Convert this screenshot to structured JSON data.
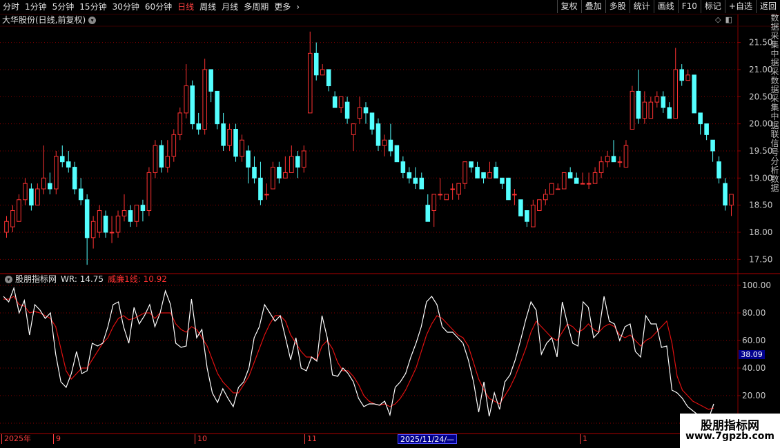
{
  "toolbar": {
    "periods": [
      "分时",
      "1分钟",
      "5分钟",
      "15分钟",
      "30分钟",
      "60分钟",
      "日线",
      "周线",
      "月线",
      "多周期",
      "更多"
    ],
    "active_period": "日线",
    "more_arrow": "chevron-right-icon",
    "right_buttons": [
      "复权",
      "叠加",
      "多股",
      "统计",
      "画线",
      "F10",
      "标记",
      "+自选",
      "返回"
    ]
  },
  "stock": {
    "title": "大华股份(日线,前复权)",
    "dropdown_icon": "chevron-down-icon"
  },
  "top_icons": [
    "diamond-icon",
    "window-icon"
  ],
  "indicator": {
    "name": "股朋指标网",
    "wr_label": "WR: 14.75",
    "line1_label": "威廉1线: 10.92",
    "wr_tag": "38.09"
  },
  "dates": {
    "year_label": "2025年",
    "m9": "9",
    "m10": "10",
    "m11": "11",
    "cursor": "2025/11/24/—",
    "m1": "1"
  },
  "watermark": {
    "name": "股朋指标网",
    "url": "www.7gpzb.com"
  },
  "right_strip_text": [
    "数",
    "据",
    "采",
    "集",
    "中",
    "据",
    "采",
    "数",
    "据",
    "采",
    "集",
    "中",
    "据",
    "联",
    "信",
    "号",
    "分",
    "析",
    "数",
    "据"
  ],
  "colors": {
    "up": "#ff3232",
    "down": "#54ffff",
    "grid": "#8b0000",
    "wr_line": "#ffffff",
    "line1": "#e01010",
    "axis_text": "#c8c8c8"
  },
  "chart_data": [
    {
      "type": "candlestick",
      "title": "大华股份(日线,前复权)",
      "ylim": [
        17.25,
        21.8
      ],
      "y_ticks": [
        17.5,
        18.0,
        18.5,
        19.0,
        19.5,
        20.0,
        20.5,
        21.0,
        21.5
      ],
      "y_tick_labels": [
        "17.50",
        "18.00",
        "18.50",
        "19.00",
        "19.50",
        "20.00",
        "20.50",
        "21.00",
        "21.50"
      ],
      "grid": true,
      "candles": [
        {
          "o": 18.0,
          "h": 18.3,
          "l": 17.9,
          "c": 18.2
        },
        {
          "o": 18.1,
          "h": 18.5,
          "l": 18.0,
          "c": 18.4
        },
        {
          "o": 18.2,
          "h": 18.7,
          "l": 18.2,
          "c": 18.6
        },
        {
          "o": 18.6,
          "h": 19.0,
          "l": 18.5,
          "c": 18.9
        },
        {
          "o": 18.8,
          "h": 18.9,
          "l": 18.4,
          "c": 18.5
        },
        {
          "o": 18.5,
          "h": 18.9,
          "l": 18.5,
          "c": 18.8
        },
        {
          "o": 18.8,
          "h": 19.6,
          "l": 18.7,
          "c": 19.0
        },
        {
          "o": 18.9,
          "h": 19.1,
          "l": 18.7,
          "c": 18.8
        },
        {
          "o": 18.8,
          "h": 19.5,
          "l": 18.7,
          "c": 19.4
        },
        {
          "o": 19.4,
          "h": 19.6,
          "l": 19.2,
          "c": 19.3
        },
        {
          "o": 19.3,
          "h": 19.5,
          "l": 19.1,
          "c": 19.2
        },
        {
          "o": 19.2,
          "h": 19.3,
          "l": 18.7,
          "c": 18.8
        },
        {
          "o": 18.8,
          "h": 19.0,
          "l": 18.5,
          "c": 18.6
        },
        {
          "o": 18.6,
          "h": 18.7,
          "l": 17.4,
          "c": 17.9
        },
        {
          "o": 17.9,
          "h": 18.3,
          "l": 17.7,
          "c": 18.2
        },
        {
          "o": 18.0,
          "h": 18.5,
          "l": 17.9,
          "c": 18.4
        },
        {
          "o": 18.3,
          "h": 18.4,
          "l": 17.9,
          "c": 18.0
        },
        {
          "o": 18.0,
          "h": 18.3,
          "l": 17.8,
          "c": 18.0
        },
        {
          "o": 18.0,
          "h": 18.4,
          "l": 17.9,
          "c": 18.3
        },
        {
          "o": 18.3,
          "h": 18.7,
          "l": 18.2,
          "c": 18.4
        },
        {
          "o": 18.4,
          "h": 18.5,
          "l": 18.1,
          "c": 18.2
        },
        {
          "o": 18.2,
          "h": 18.5,
          "l": 18.1,
          "c": 18.5
        },
        {
          "o": 18.5,
          "h": 18.6,
          "l": 18.2,
          "c": 18.4
        },
        {
          "o": 18.4,
          "h": 19.2,
          "l": 18.3,
          "c": 19.1
        },
        {
          "o": 19.1,
          "h": 19.7,
          "l": 19.0,
          "c": 19.6
        },
        {
          "o": 19.6,
          "h": 19.7,
          "l": 19.1,
          "c": 19.2
        },
        {
          "o": 19.2,
          "h": 19.7,
          "l": 19.1,
          "c": 19.4
        },
        {
          "o": 19.4,
          "h": 19.9,
          "l": 19.3,
          "c": 19.8
        },
        {
          "o": 19.8,
          "h": 20.3,
          "l": 19.7,
          "c": 20.2
        },
        {
          "o": 20.2,
          "h": 21.1,
          "l": 20.1,
          "c": 20.7
        },
        {
          "o": 20.7,
          "h": 20.8,
          "l": 19.9,
          "c": 20.0
        },
        {
          "o": 20.0,
          "h": 20.2,
          "l": 19.8,
          "c": 19.9
        },
        {
          "o": 19.9,
          "h": 21.2,
          "l": 19.8,
          "c": 21.0
        },
        {
          "o": 21.0,
          "h": 21.0,
          "l": 20.4,
          "c": 20.6
        },
        {
          "o": 20.6,
          "h": 20.6,
          "l": 19.9,
          "c": 20.0
        },
        {
          "o": 20.0,
          "h": 20.2,
          "l": 19.5,
          "c": 19.6
        },
        {
          "o": 19.6,
          "h": 20.0,
          "l": 19.5,
          "c": 19.9
        },
        {
          "o": 19.9,
          "h": 20.0,
          "l": 19.3,
          "c": 19.4
        },
        {
          "o": 19.4,
          "h": 19.8,
          "l": 19.3,
          "c": 19.7
        },
        {
          "o": 19.5,
          "h": 19.6,
          "l": 18.9,
          "c": 19.2
        },
        {
          "o": 19.2,
          "h": 19.4,
          "l": 18.9,
          "c": 19.0
        },
        {
          "o": 19.0,
          "h": 19.3,
          "l": 18.5,
          "c": 18.6
        },
        {
          "o": 18.7,
          "h": 18.9,
          "l": 18.6,
          "c": 18.7
        },
        {
          "o": 18.8,
          "h": 19.3,
          "l": 18.8,
          "c": 19.2
        },
        {
          "o": 19.2,
          "h": 19.3,
          "l": 18.9,
          "c": 19.0
        },
        {
          "o": 19.0,
          "h": 19.4,
          "l": 19.0,
          "c": 19.1
        },
        {
          "o": 19.1,
          "h": 19.6,
          "l": 19.1,
          "c": 19.4
        },
        {
          "o": 19.4,
          "h": 19.5,
          "l": 19.0,
          "c": 19.2
        },
        {
          "o": 19.2,
          "h": 19.6,
          "l": 19.1,
          "c": 19.5
        },
        {
          "o": 20.2,
          "h": 21.7,
          "l": 20.2,
          "c": 21.3
        },
        {
          "o": 21.3,
          "h": 21.5,
          "l": 20.8,
          "c": 20.9
        },
        {
          "o": 20.9,
          "h": 21.1,
          "l": 20.9,
          "c": 21.0
        },
        {
          "o": 21.0,
          "h": 21.0,
          "l": 20.6,
          "c": 20.7
        },
        {
          "o": 20.5,
          "h": 20.6,
          "l": 20.3,
          "c": 20.3
        },
        {
          "o": 20.3,
          "h": 20.5,
          "l": 20.2,
          "c": 20.5
        },
        {
          "o": 20.4,
          "h": 20.5,
          "l": 20.0,
          "c": 20.1
        },
        {
          "o": 19.8,
          "h": 20.0,
          "l": 19.5,
          "c": 20.0
        },
        {
          "o": 20.1,
          "h": 20.5,
          "l": 20.0,
          "c": 20.3
        },
        {
          "o": 20.3,
          "h": 20.4,
          "l": 20.0,
          "c": 20.2
        },
        {
          "o": 20.2,
          "h": 20.2,
          "l": 19.8,
          "c": 19.9
        },
        {
          "o": 20.0,
          "h": 20.1,
          "l": 19.5,
          "c": 19.6
        },
        {
          "o": 19.6,
          "h": 19.8,
          "l": 19.4,
          "c": 19.7
        },
        {
          "o": 19.7,
          "h": 20.0,
          "l": 19.4,
          "c": 19.5
        },
        {
          "o": 19.6,
          "h": 19.6,
          "l": 19.3,
          "c": 19.3
        },
        {
          "o": 19.3,
          "h": 19.4,
          "l": 19.0,
          "c": 19.1
        },
        {
          "o": 19.1,
          "h": 19.2,
          "l": 18.9,
          "c": 19.0
        },
        {
          "o": 19.0,
          "h": 19.2,
          "l": 18.8,
          "c": 18.9
        },
        {
          "o": 19.0,
          "h": 19.1,
          "l": 18.8,
          "c": 18.8
        },
        {
          "o": 18.5,
          "h": 18.7,
          "l": 18.2,
          "c": 18.2
        },
        {
          "o": 18.4,
          "h": 18.7,
          "l": 18.1,
          "c": 18.7
        },
        {
          "o": 18.7,
          "h": 19.0,
          "l": 18.6,
          "c": 18.7
        },
        {
          "o": 18.6,
          "h": 18.7,
          "l": 18.6,
          "c": 18.7
        },
        {
          "o": 18.8,
          "h": 18.9,
          "l": 18.6,
          "c": 18.8
        },
        {
          "o": 18.7,
          "h": 18.9,
          "l": 18.6,
          "c": 18.9
        },
        {
          "o": 18.9,
          "h": 19.3,
          "l": 18.8,
          "c": 19.3
        },
        {
          "o": 19.3,
          "h": 19.3,
          "l": 19.1,
          "c": 19.2
        },
        {
          "o": 19.2,
          "h": 19.3,
          "l": 19.0,
          "c": 19.0
        },
        {
          "o": 19.1,
          "h": 19.1,
          "l": 18.9,
          "c": 19.0
        },
        {
          "o": 19.0,
          "h": 19.3,
          "l": 19.0,
          "c": 19.1
        },
        {
          "o": 19.2,
          "h": 19.3,
          "l": 19.0,
          "c": 19.0
        },
        {
          "o": 19.0,
          "h": 19.0,
          "l": 18.8,
          "c": 18.9
        },
        {
          "o": 19.0,
          "h": 19.0,
          "l": 18.6,
          "c": 18.6
        },
        {
          "o": 18.7,
          "h": 18.8,
          "l": 18.5,
          "c": 18.7
        },
        {
          "o": 18.6,
          "h": 18.6,
          "l": 18.3,
          "c": 18.3
        },
        {
          "o": 18.4,
          "h": 18.4,
          "l": 18.1,
          "c": 18.2
        },
        {
          "o": 18.1,
          "h": 18.6,
          "l": 18.1,
          "c": 18.5
        },
        {
          "o": 18.4,
          "h": 18.6,
          "l": 18.4,
          "c": 18.6
        },
        {
          "o": 18.6,
          "h": 18.8,
          "l": 18.5,
          "c": 18.7
        },
        {
          "o": 18.7,
          "h": 18.9,
          "l": 18.7,
          "c": 18.9
        },
        {
          "o": 18.8,
          "h": 18.9,
          "l": 18.8,
          "c": 18.8
        },
        {
          "o": 18.8,
          "h": 19.1,
          "l": 18.8,
          "c": 19.1
        },
        {
          "o": 19.1,
          "h": 19.2,
          "l": 19.0,
          "c": 19.0
        },
        {
          "o": 19.0,
          "h": 19.1,
          "l": 18.9,
          "c": 18.9
        },
        {
          "o": 18.9,
          "h": 19.1,
          "l": 18.9,
          "c": 18.9
        },
        {
          "o": 18.9,
          "h": 19.1,
          "l": 18.8,
          "c": 18.9
        },
        {
          "o": 18.9,
          "h": 19.2,
          "l": 18.9,
          "c": 19.1
        },
        {
          "o": 19.1,
          "h": 19.4,
          "l": 19.0,
          "c": 19.3
        },
        {
          "o": 19.3,
          "h": 19.5,
          "l": 19.2,
          "c": 19.4
        },
        {
          "o": 19.4,
          "h": 19.7,
          "l": 19.3,
          "c": 19.3
        },
        {
          "o": 19.3,
          "h": 19.4,
          "l": 19.2,
          "c": 19.3
        },
        {
          "o": 19.2,
          "h": 19.7,
          "l": 19.2,
          "c": 19.6
        },
        {
          "o": 19.9,
          "h": 20.7,
          "l": 19.9,
          "c": 20.6
        },
        {
          "o": 20.6,
          "h": 21.0,
          "l": 20.0,
          "c": 20.1
        },
        {
          "o": 20.1,
          "h": 20.6,
          "l": 20.0,
          "c": 20.4
        },
        {
          "o": 20.1,
          "h": 20.5,
          "l": 20.1,
          "c": 20.4
        },
        {
          "o": 20.4,
          "h": 20.6,
          "l": 20.3,
          "c": 20.5
        },
        {
          "o": 20.5,
          "h": 20.6,
          "l": 20.2,
          "c": 20.3
        },
        {
          "o": 20.3,
          "h": 20.4,
          "l": 20.1,
          "c": 20.1
        },
        {
          "o": 20.1,
          "h": 21.4,
          "l": 20.1,
          "c": 21.0
        },
        {
          "o": 21.0,
          "h": 21.1,
          "l": 20.7,
          "c": 20.8
        },
        {
          "o": 20.8,
          "h": 21.0,
          "l": 20.8,
          "c": 20.9
        },
        {
          "o": 20.9,
          "h": 20.9,
          "l": 20.2,
          "c": 20.2
        },
        {
          "o": 20.2,
          "h": 20.2,
          "l": 19.8,
          "c": 20.0
        },
        {
          "o": 20.0,
          "h": 20.0,
          "l": 19.7,
          "c": 19.8
        },
        {
          "o": 19.7,
          "h": 19.7,
          "l": 19.3,
          "c": 19.5
        },
        {
          "o": 19.3,
          "h": 19.4,
          "l": 18.9,
          "c": 19.0
        },
        {
          "o": 18.9,
          "h": 19.0,
          "l": 18.4,
          "c": 18.5
        },
        {
          "o": 18.5,
          "h": 18.7,
          "l": 18.3,
          "c": 18.7
        }
      ]
    },
    {
      "type": "line",
      "title": "股朋指标网",
      "ylim": [
        -7,
        108
      ],
      "y_ticks": [
        0,
        20,
        40,
        60,
        80,
        100
      ],
      "y_tick_labels": [
        "0.00",
        "20.00",
        "40.00",
        "60.00",
        "80.00",
        "100.00"
      ],
      "grid": true,
      "series": [
        {
          "name": "WR",
          "values": [
            92,
            88,
            98,
            80,
            89,
            64,
            86,
            82,
            76,
            80,
            50,
            30,
            26,
            36,
            52,
            36,
            38,
            58,
            56,
            58,
            70,
            86,
            88,
            70,
            58,
            84,
            72,
            78,
            86,
            70,
            80,
            96,
            86,
            58,
            55,
            56,
            90,
            62,
            68,
            40,
            22,
            15,
            25,
            18,
            12,
            26,
            30,
            40,
            62,
            70,
            86,
            80,
            74,
            78,
            62,
            46,
            62,
            40,
            38,
            48,
            45,
            78,
            62,
            35,
            34,
            40,
            36,
            30,
            18,
            12,
            14,
            14,
            13,
            16,
            6,
            26,
            30,
            36,
            48,
            58,
            70,
            88,
            92,
            86,
            70,
            66,
            66,
            62,
            58,
            46,
            30,
            8,
            30,
            5,
            22,
            10,
            30,
            35,
            46,
            60,
            75,
            88,
            82,
            50,
            58,
            62,
            48,
            88,
            72,
            58,
            56,
            88,
            84,
            62,
            66,
            92,
            74,
            72,
            60,
            70,
            72,
            52,
            48,
            78,
            72,
            72,
            55,
            56,
            24,
            22,
            18,
            12,
            9,
            6,
            5,
            3,
            14
          ],
          "color": "#ffffff"
        },
        {
          "name": "威廉1线",
          "values": [
            90,
            90,
            92,
            86,
            85,
            80,
            81,
            80,
            78,
            76,
            70,
            54,
            38,
            32,
            36,
            40,
            40,
            46,
            52,
            58,
            62,
            70,
            76,
            78,
            75,
            76,
            78,
            80,
            80,
            76,
            80,
            80,
            80,
            72,
            68,
            66,
            70,
            68,
            62,
            56,
            46,
            36,
            30,
            26,
            22,
            22,
            28,
            34,
            44,
            54,
            64,
            72,
            78,
            78,
            74,
            64,
            58,
            52,
            48,
            48,
            46,
            56,
            60,
            54,
            44,
            38,
            38,
            34,
            28,
            20,
            16,
            14,
            13,
            14,
            12,
            14,
            18,
            24,
            32,
            40,
            52,
            64,
            72,
            78,
            76,
            72,
            68,
            64,
            62,
            56,
            44,
            32,
            24,
            18,
            16,
            14,
            20,
            26,
            34,
            44,
            54,
            66,
            74,
            70,
            66,
            62,
            60,
            66,
            72,
            70,
            66,
            68,
            72,
            68,
            66,
            70,
            72,
            70,
            64,
            62,
            64,
            60,
            56,
            60,
            62,
            66,
            70,
            74,
            58,
            34,
            24,
            20,
            16,
            14,
            12,
            10,
            11
          ],
          "color": "#e01010"
        }
      ]
    }
  ]
}
